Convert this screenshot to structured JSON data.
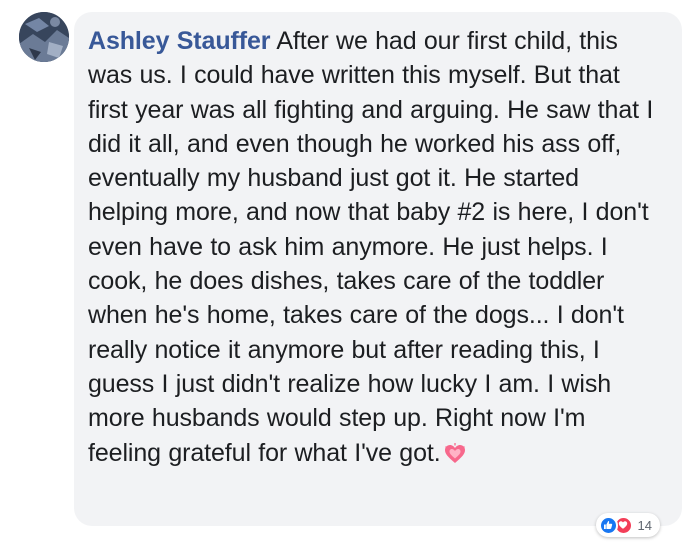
{
  "comment": {
    "author": "Ashley Stauffer",
    "text": "After we had our first child, this was us. I could have written this myself. But that first year was all fighting and arguing. He saw that I did it all, and even though he worked his ass off, eventually my husband just got it. He started helping more, and now that baby #2 is here, I don't even have to ask him anymore. He just helps. I cook, he does dishes, takes care of the toddler when he's home, takes care of the dogs... I don't really notice it anymore but after reading this, I guess I just didn't realize how lucky I am. I wish more husbands would step up. Right now I'm feeling grateful for what I've got.",
    "emoji": "growing-heart-icon"
  },
  "reactions": {
    "types": [
      "like-icon",
      "love-icon"
    ],
    "count": "14"
  },
  "colors": {
    "bubble_bg": "#f2f3f5",
    "author": "#385898",
    "text": "#1c1e21",
    "like": "#1877f2",
    "love": "#f33e58"
  }
}
